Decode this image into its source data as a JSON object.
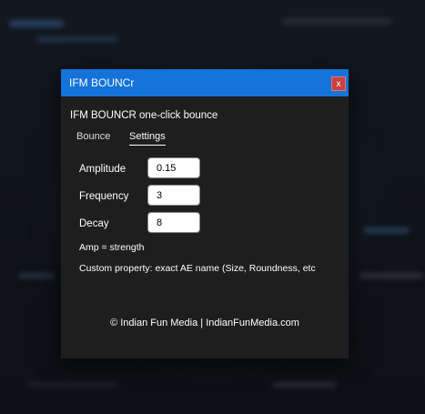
{
  "window": {
    "title": "IFM BOUNCr",
    "close_label": "x"
  },
  "header": {
    "text": "IFM BOUNCR  one-click bounce"
  },
  "tabs": [
    {
      "label": "Bounce",
      "active": false
    },
    {
      "label": "Settings",
      "active": true
    }
  ],
  "settings": {
    "amplitude": {
      "label": "Amplitude",
      "value": "0.15"
    },
    "frequency": {
      "label": "Frequency",
      "value": "3"
    },
    "decay": {
      "label": "Decay",
      "value": "8"
    }
  },
  "notes": {
    "amp": "Amp = strength",
    "custom": "Custom property: exact AE name (Size, Roundness, etc"
  },
  "footer": {
    "text": "© Indian Fun Media | IndianFunMedia.com"
  },
  "colors": {
    "titlebar": "#1473d9",
    "panel": "#1e1e1e",
    "close_button": "#c8413f"
  }
}
